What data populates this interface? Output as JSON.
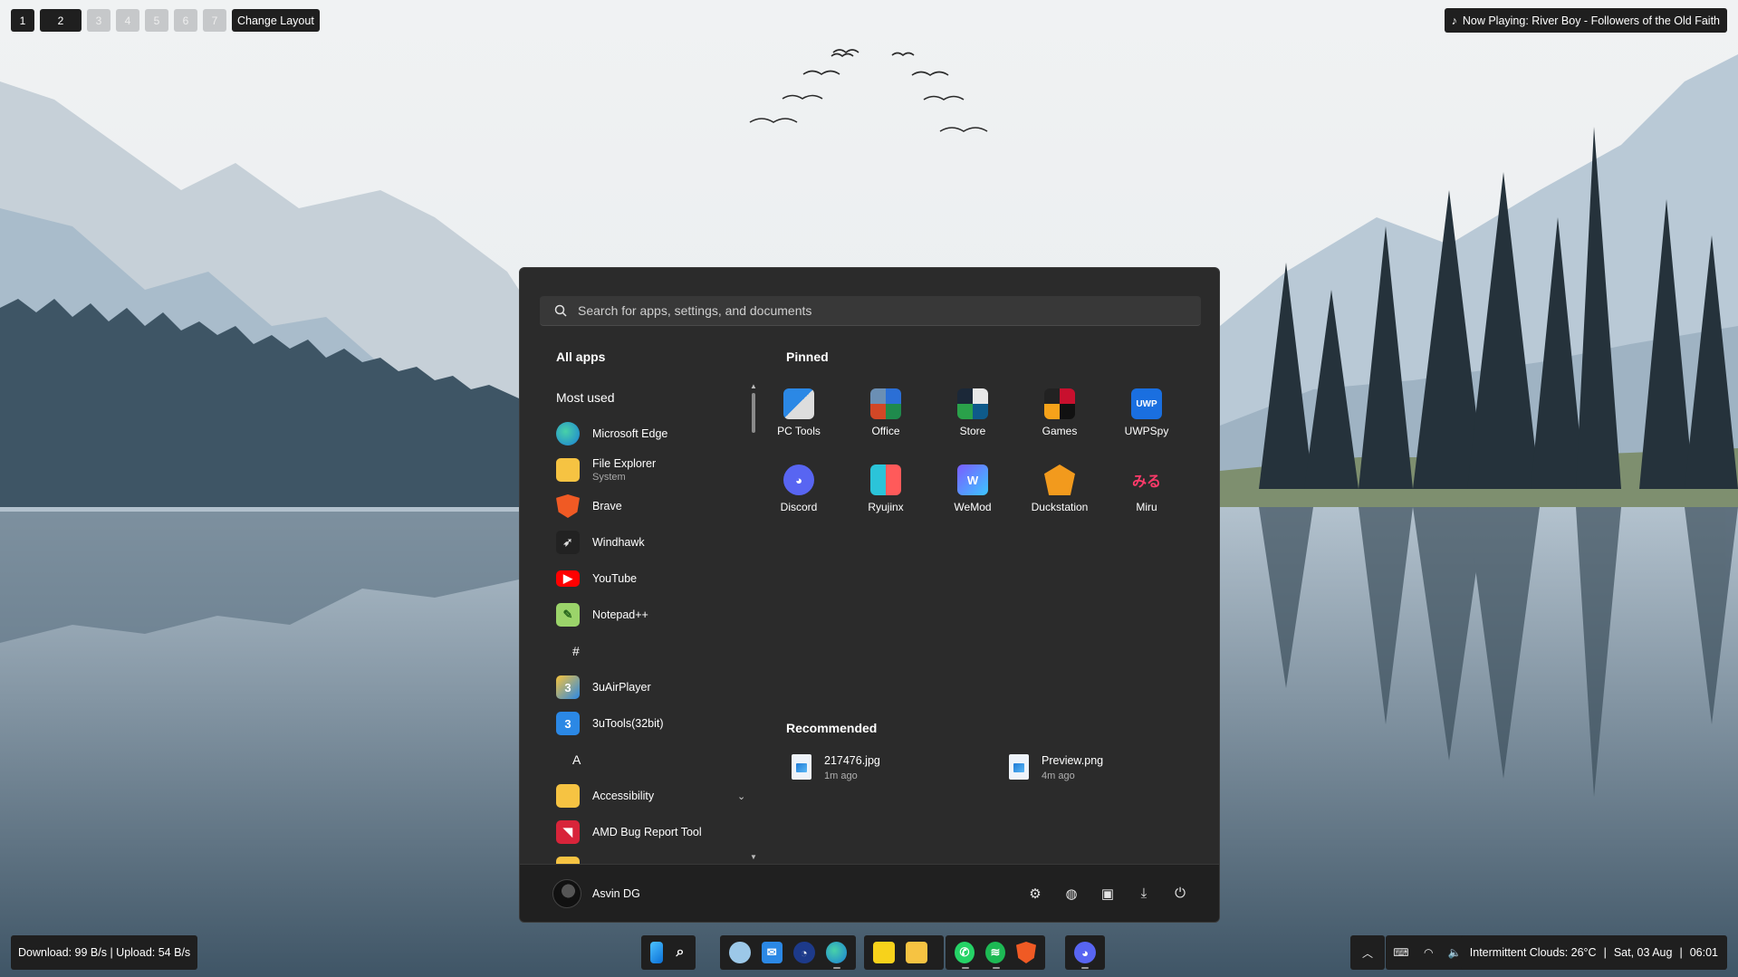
{
  "topbar": {
    "workspaces": [
      "1",
      "2",
      "3",
      "4",
      "5",
      "6",
      "7"
    ],
    "change_layout": "Change Layout",
    "now_playing": "Now Playing: River Boy - Followers of the Old Faith"
  },
  "start_menu": {
    "search_placeholder": "Search for apps, settings, and documents",
    "all_apps_title": "All apps",
    "most_used_title": "Most used",
    "apps": [
      {
        "label": "Microsoft Edge",
        "sub": ""
      },
      {
        "label": "File Explorer",
        "sub": "System"
      },
      {
        "label": "Brave",
        "sub": ""
      },
      {
        "label": "Windhawk",
        "sub": ""
      },
      {
        "label": "YouTube",
        "sub": ""
      },
      {
        "label": "Notepad++",
        "sub": ""
      }
    ],
    "letter_hash": "#",
    "apps_hash": [
      {
        "label": "3uAirPlayer"
      },
      {
        "label": "3uTools(32bit)"
      }
    ],
    "letter_a": "A",
    "apps_a": [
      {
        "label": "Accessibility"
      },
      {
        "label": "AMD Bug Report Tool"
      }
    ],
    "pinned_title": "Pinned",
    "pinned": [
      {
        "label": "PC Tools"
      },
      {
        "label": "Office"
      },
      {
        "label": "Store"
      },
      {
        "label": "Games"
      },
      {
        "label": "UWPSpy"
      },
      {
        "label": "Discord"
      },
      {
        "label": "Ryujinx"
      },
      {
        "label": "WeMod"
      },
      {
        "label": "Duckstation"
      },
      {
        "label": "Miru"
      }
    ],
    "recommended_title": "Recommended",
    "recommended": [
      {
        "name": "217476.jpg",
        "time": "1m ago"
      },
      {
        "name": "Preview.png",
        "time": "4m ago"
      }
    ],
    "user_name": "Asvin DG"
  },
  "taskbar": {
    "net_speed": "Download: 99 B/s | Upload: 54 B/s",
    "weather": "Intermittent Clouds: 26°C",
    "date": "Sat, 03 Aug",
    "time": "06:01",
    "separator": "|"
  },
  "colors": {
    "menu_bg": "#2b2b2b",
    "footer_bg": "#202020",
    "bar_bg": "#1f1f1f",
    "accent_blue": "#1e7ad6"
  }
}
